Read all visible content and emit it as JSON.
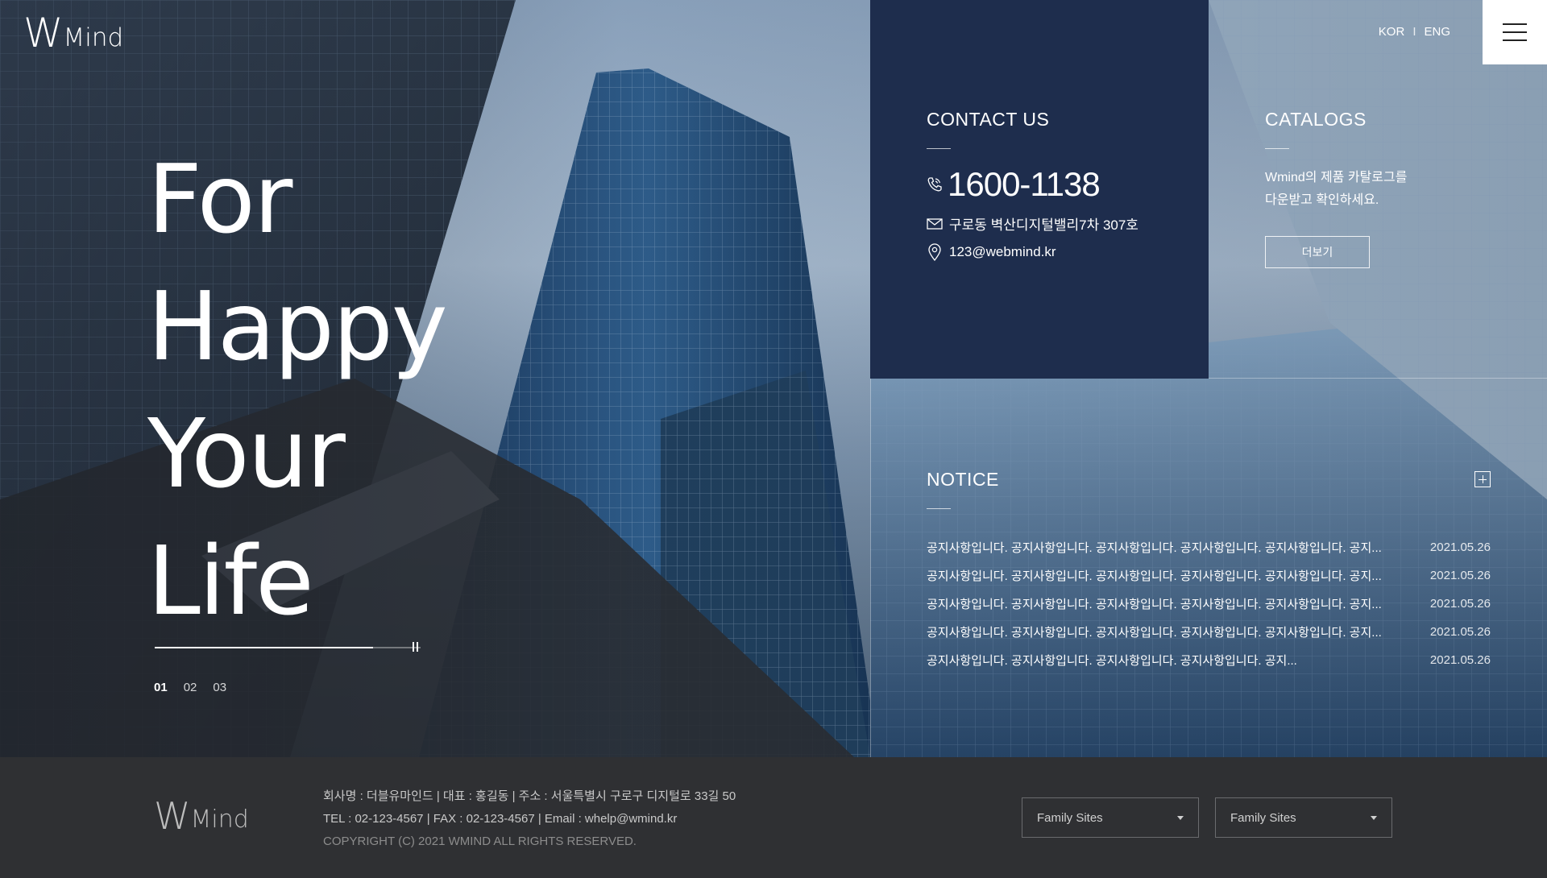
{
  "header": {
    "logo": {
      "w": "W",
      "mind": "Mind"
    },
    "lang": {
      "kor": "KOR",
      "sep": "I",
      "eng": "ENG"
    },
    "menu_icon": "hamburger-icon"
  },
  "hero": {
    "slogan": [
      "For",
      "Happy",
      "Your",
      "Life"
    ],
    "progress": 0.82,
    "pager": [
      "01",
      "02",
      "03"
    ],
    "active_slide": "01"
  },
  "contact": {
    "title": "CONTACT US",
    "phone": "1600-1138",
    "address": "구로동 벽산디지털밸리7차 307호",
    "email": "123@webmind.kr",
    "bg_color": "#1e2d4d"
  },
  "catalogs": {
    "title": "CATALOGS",
    "desc_line1": "Wmind의 제품 카탈로그를",
    "desc_line2": "다운받고 확인하세요.",
    "button": "더보기"
  },
  "notice": {
    "title": "NOTICE",
    "items": [
      {
        "title": "공지사항입니다. 공지사항입니다. 공지사항입니다. 공지사항입니다.  공지사항입니다.  공지...",
        "date": "2021.05.26"
      },
      {
        "title": "공지사항입니다. 공지사항입니다. 공지사항입니다. 공지사항입니다.  공지사항입니다. 공지...",
        "date": "2021.05.26"
      },
      {
        "title": "공지사항입니다. 공지사항입니다. 공지사항입니다. 공지사항입니다.  공지사항입니다. 공지...",
        "date": "2021.05.26"
      },
      {
        "title": "공지사항입니다. 공지사항입니다. 공지사항입니다. 공지사항입니다.  공지사항입니다. 공지...",
        "date": "2021.05.26"
      },
      {
        "title": "공지사항입니다. 공지사항입니다. 공지사항입니다. 공지사항입니다.  공지...",
        "date": "2021.05.26"
      }
    ]
  },
  "footer": {
    "logo": {
      "w": "W",
      "mind": "Mind"
    },
    "line1": "회사명 : 더블유마인드  |  대표 : 홍길동  |  주소 : 서울특별시 구로구 디지털로 33길 50",
    "line2": "TEL : 02-123-4567  |  FAX : 02-123-4567  |  Email : whelp@wmind.kr",
    "copyright": "COPYRIGHT (C) 2021 WMIND ALL RIGHTS RESERVED.",
    "family_sites_1": "Family Sites",
    "family_sites_2": "Family Sites"
  }
}
